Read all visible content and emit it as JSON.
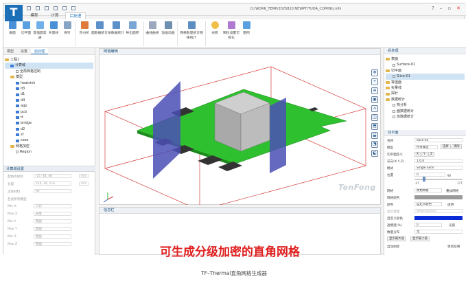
{
  "app": {
    "logo": "T",
    "window_title": "D:/WORK_TEMP/2025810 NEWPT/TUOA_COMING.mhi",
    "tabs": [
      "模型",
      "计算",
      "后处理"
    ],
    "active_tab": 2
  },
  "ribbon": {
    "buttons": [
      "表面",
      "切平面",
      "等值面高通",
      "矢量线",
      "探针",
      "热分析",
      "面数据统计",
      "体数据统计",
      "导出面积",
      "曲线曲线",
      "动画动画",
      "网格数量统计网格统计",
      "光照",
      "颗粒设置可视化",
      "图例"
    ]
  },
  "left_panel": {
    "tabs": [
      "模型",
      "设置",
      "后处理"
    ],
    "active_tab": 2,
    "tree": [
      {
        "label": "工程1",
        "level": 0,
        "kind": "folder"
      },
      {
        "label": "计算域",
        "level": 1,
        "kind": "block",
        "selected": true
      },
      {
        "label": "全局网格控制",
        "level": 2,
        "kind": "box"
      },
      {
        "label": "模型",
        "level": 1,
        "kind": "folder"
      },
      {
        "label": "heatsink",
        "level": 2,
        "kind": "block"
      },
      {
        "label": "d3",
        "level": 2,
        "kind": "block"
      },
      {
        "label": "d1",
        "level": 2,
        "kind": "block"
      },
      {
        "label": "d4",
        "level": 2,
        "kind": "block"
      },
      {
        "label": "agp",
        "level": 2,
        "kind": "block"
      },
      {
        "label": "pcb",
        "level": 2,
        "kind": "block"
      },
      {
        "label": "tt",
        "level": 2,
        "kind": "block"
      },
      {
        "label": "bridge",
        "level": 2,
        "kind": "block"
      },
      {
        "label": "d2",
        "level": 2,
        "kind": "block"
      },
      {
        "label": "sf",
        "level": 2,
        "kind": "block"
      },
      {
        "label": "case",
        "level": 2,
        "kind": "block"
      },
      {
        "label": "网格加密",
        "level": 1,
        "kind": "folder"
      },
      {
        "label": "Region",
        "level": 2,
        "kind": "box"
      }
    ],
    "domain_section_title": "计算域设置",
    "domain_fields": [
      {
        "label": "起始点坐标",
        "value": "-27, 44, 48",
        "unit": "mm"
      },
      {
        "label": "长度",
        "value": "214, 26, 114",
        "unit": "mm"
      },
      {
        "label": "流体材料",
        "value": "Air",
        "unit": ""
      },
      {
        "label": "包含所有模型",
        "value": "",
        "unit": ""
      },
      {
        "label": "Min X",
        "value": "入口",
        "unit": ""
      },
      {
        "label": "Max X",
        "value": "开放",
        "unit": ""
      },
      {
        "label": "Min Y",
        "value": "壁面",
        "unit": ""
      },
      {
        "label": "Max Y",
        "value": "壁面",
        "unit": ""
      },
      {
        "label": "Min Z",
        "value": "壁面",
        "unit": ""
      },
      {
        "label": "Max Z",
        "value": "壁面",
        "unit": ""
      }
    ]
  },
  "viewport": {
    "title": "网格编辑",
    "brand": "TenFong",
    "tools": [
      "✥",
      "+",
      "⊕",
      "▣",
      "⌂",
      "◫",
      "⬒",
      "⬓",
      "⬔",
      "⬕"
    ]
  },
  "message_panel": {
    "title": "信息栏",
    "overlay_text": "可生成分级加密的直角网格"
  },
  "right_panel": {
    "post_title": "后处理",
    "post_tree": [
      {
        "label": "表面",
        "level": 0
      },
      {
        "label": "Surface-01",
        "level": 1
      },
      {
        "label": "切平面",
        "level": 0
      },
      {
        "label": "Slice-01",
        "level": 1,
        "selected": true
      },
      {
        "label": "等值面",
        "level": 0
      },
      {
        "label": "矢量线",
        "level": 0
      },
      {
        "label": "探针",
        "level": 0
      },
      {
        "label": "数据统计",
        "level": 0
      },
      {
        "label": "热分析",
        "level": 1
      },
      {
        "label": "面数据统计",
        "level": 1
      },
      {
        "label": "体数据统计",
        "level": 1
      }
    ],
    "props_title": "切平面",
    "props": {
      "name_label": "名称",
      "name_value": "Slice-01",
      "model_label": "模型",
      "model_value": "所有模型",
      "select_btn": "选择",
      "clear_btn": "清除",
      "normal_label": "切平面定义",
      "normal_values": [
        "X",
        "Y",
        "Z"
      ],
      "vector_label": "法向(X,Y,Z)",
      "vector_value": "1,0,0",
      "mode_label": "模式",
      "mode_value": "Single Slice",
      "pos_label": "位置",
      "pos_value": "0",
      "range_min": "-27",
      "range_mid": "90",
      "range_max": "177",
      "mesh_label": "网格",
      "mesh_value": "原始网格",
      "mesh_check": "叠加网格",
      "meshcolor_label": "网格颜色",
      "color_label": "颜色",
      "color_value": "自定义颜色",
      "color_check": "透明",
      "var_label": "显示变量",
      "var_value": "Velocity(m/s)",
      "custom_label": "自定义颜色",
      "transp_label": "透明度(%)",
      "transp_value": "0",
      "light_check": "光照",
      "dist_label": "数量分布",
      "dist_value": "无",
      "btn_max": "显示最大值",
      "btn_min": "显示最小值",
      "auto_check": "自动刷新",
      "apply_btn": "更新应用"
    },
    "colors": {
      "custom": "#0a2bd6",
      "mesh": "#9a9a9a"
    }
  },
  "caption": "TF–Thermal直角网格生成器"
}
